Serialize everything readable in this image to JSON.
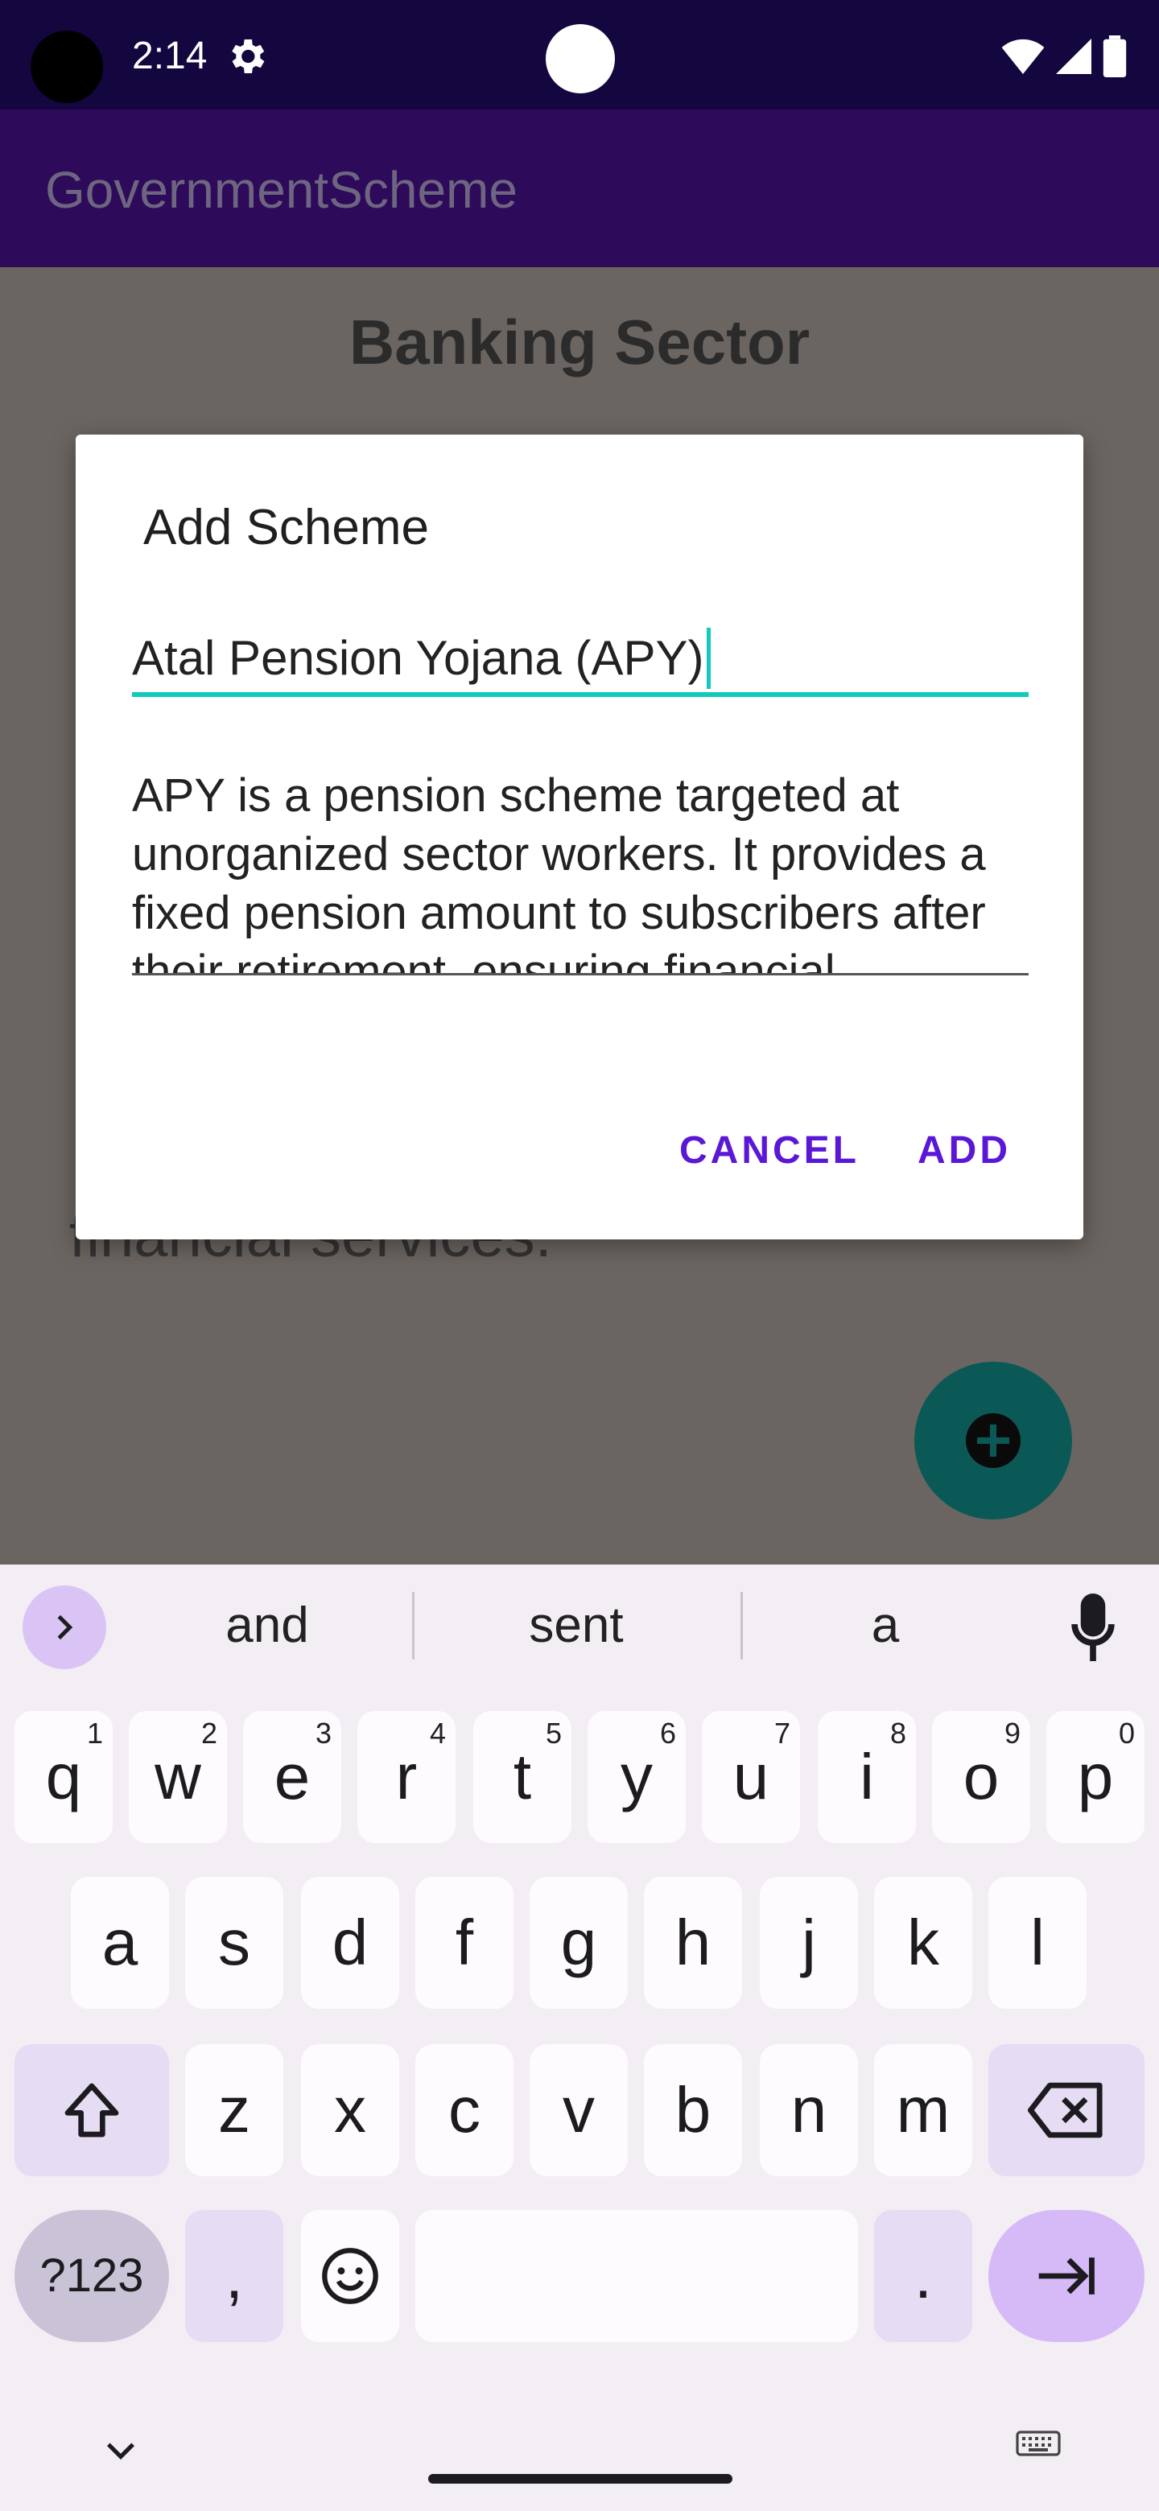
{
  "status_bar": {
    "time": "2:14",
    "icons": [
      "settings-gear-icon",
      "wifi-icon",
      "cellular-signal-icon",
      "battery-icon"
    ]
  },
  "app_bar": {
    "title": "GovernmentScheme"
  },
  "screen": {
    "section_title": "Banking Sector",
    "partial_background_text": "financial services."
  },
  "dialog": {
    "title": "Add Scheme",
    "name_field_value": "Atal Pension Yojana (APY)",
    "description_value": "APY is a pension scheme targeted at unorganized sector workers. It provides a fixed pension amount to subscribers after their retirement, ensuring financial",
    "cancel_label": "CANCEL",
    "add_label": "ADD"
  },
  "keyboard": {
    "suggestions": [
      "and",
      "sent",
      "a"
    ],
    "row1": [
      {
        "key": "q",
        "hint": "1"
      },
      {
        "key": "w",
        "hint": "2"
      },
      {
        "key": "e",
        "hint": "3"
      },
      {
        "key": "r",
        "hint": "4"
      },
      {
        "key": "t",
        "hint": "5"
      },
      {
        "key": "y",
        "hint": "6"
      },
      {
        "key": "u",
        "hint": "7"
      },
      {
        "key": "i",
        "hint": "8"
      },
      {
        "key": "o",
        "hint": "9"
      },
      {
        "key": "p",
        "hint": "0"
      }
    ],
    "row2": [
      "a",
      "s",
      "d",
      "f",
      "g",
      "h",
      "j",
      "k",
      "l"
    ],
    "row3": [
      "z",
      "x",
      "c",
      "v",
      "b",
      "n",
      "m"
    ],
    "symbols_label": "?123",
    "comma_label": ",",
    "period_label": "."
  },
  "colors": {
    "accent_teal": "#12c9bd",
    "dialog_button": "#5a18d6",
    "app_bar": "#2d0a5a",
    "fab": "#0b5957"
  }
}
